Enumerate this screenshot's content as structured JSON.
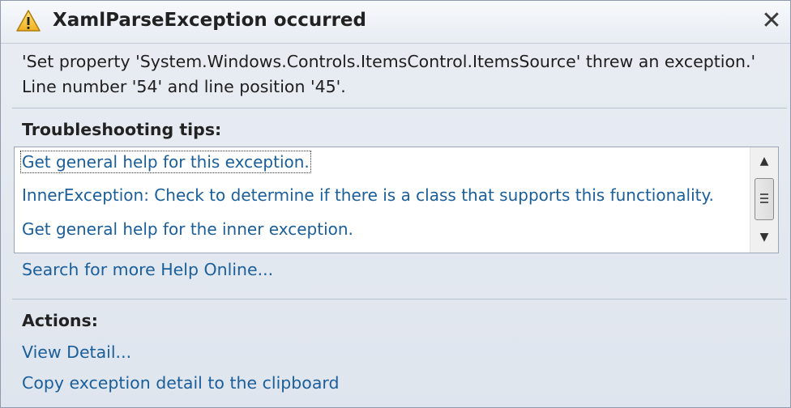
{
  "titlebar": {
    "icon": "warning-icon",
    "title": "XamlParseException occurred",
    "close_label": "✕"
  },
  "message": {
    "line1": "'Set property 'System.Windows.Controls.ItemsControl.ItemsSource' threw an exception.'",
    "line2": "Line number '54' and line position '45'."
  },
  "troubleshooting": {
    "heading": "Troubleshooting tips:",
    "tips": [
      "Get general help for this exception.",
      "InnerException: Check to determine if there is a class that supports this functionality.",
      "Get general help for the inner exception."
    ],
    "search_link": "Search for more Help Online..."
  },
  "actions": {
    "heading": "Actions:",
    "items": [
      "View Detail...",
      "Copy exception detail to the clipboard"
    ]
  },
  "colors": {
    "link": "#1a5e9a",
    "warning": "#f2c12e"
  }
}
